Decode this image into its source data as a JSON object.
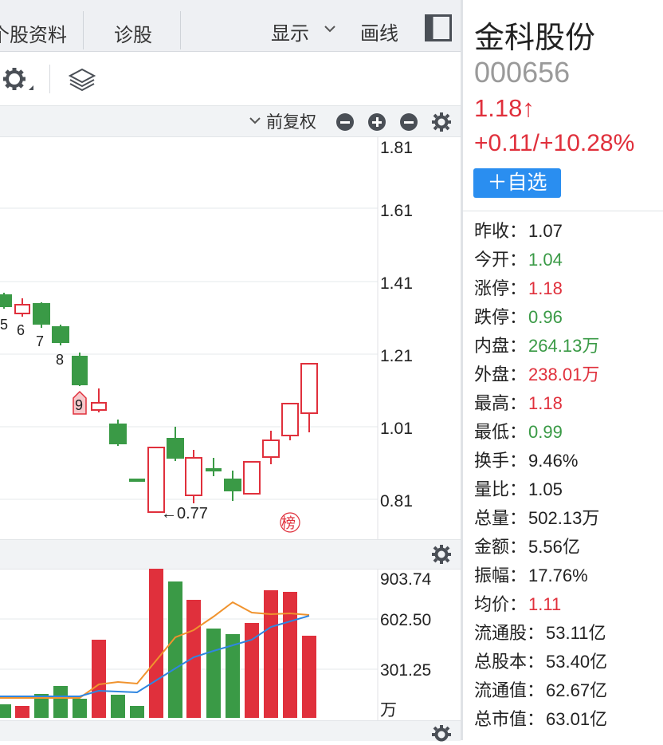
{
  "tabs": [
    {
      "label": "个股资料"
    },
    {
      "label": "诊股"
    }
  ],
  "tab_actions": {
    "display_label": "显示",
    "draw_label": "画线"
  },
  "subbar": {
    "adjust_label": "前复权"
  },
  "kline": {
    "y_ticks": [
      "1.81",
      "1.61",
      "1.41",
      "1.21",
      "1.01",
      "0.81"
    ],
    "candle_labels": [
      "5",
      "6",
      "7",
      "8",
      "9"
    ],
    "low_marker": "←0.77",
    "badge": "榜"
  },
  "volume": {
    "y_ticks": [
      "903.74",
      "602.50",
      "301.25"
    ],
    "unit": "万"
  },
  "stock": {
    "name": "金科股份",
    "code": "000656",
    "price": "1.18↑",
    "change": "+0.11/+10.28%",
    "watch_button": "＋自选"
  },
  "stats": [
    {
      "label": "昨收",
      "value": "1.07",
      "color": "#222222"
    },
    {
      "label": "今开",
      "value": "1.04",
      "color": "#3a9a46"
    },
    {
      "label": "涨停",
      "value": "1.18",
      "color": "#e0303c"
    },
    {
      "label": "跌停",
      "value": "0.96",
      "color": "#3a9a46"
    },
    {
      "label": "内盘",
      "value": "264.13万",
      "color": "#3a9a46"
    },
    {
      "label": "外盘",
      "value": "238.01万",
      "color": "#e0303c"
    },
    {
      "label": "最高",
      "value": "1.18",
      "color": "#e0303c"
    },
    {
      "label": "最低",
      "value": "0.99",
      "color": "#3a9a46"
    },
    {
      "label": "换手",
      "value": "9.46%",
      "color": "#222222"
    },
    {
      "label": "量比",
      "value": "1.05",
      "color": "#222222"
    },
    {
      "label": "总量",
      "value": "502.13万",
      "color": "#222222"
    },
    {
      "label": "金额",
      "value": "5.56亿",
      "color": "#222222"
    },
    {
      "label": "振幅",
      "value": "17.76%",
      "color": "#222222"
    },
    {
      "label": "均价",
      "value": "1.11",
      "color": "#e0303c"
    },
    {
      "label": "流通股",
      "value": "53.11亿",
      "color": "#222222"
    },
    {
      "label": "总股本",
      "value": "53.40亿",
      "color": "#222222"
    },
    {
      "label": "流通值",
      "value": "62.67亿",
      "color": "#222222"
    },
    {
      "label": "总市值",
      "value": "63.01亿",
      "color": "#222222"
    }
  ],
  "colors": {
    "up": "#e0303c",
    "down": "#3a9a46",
    "accent": "#2a8ef0"
  }
}
